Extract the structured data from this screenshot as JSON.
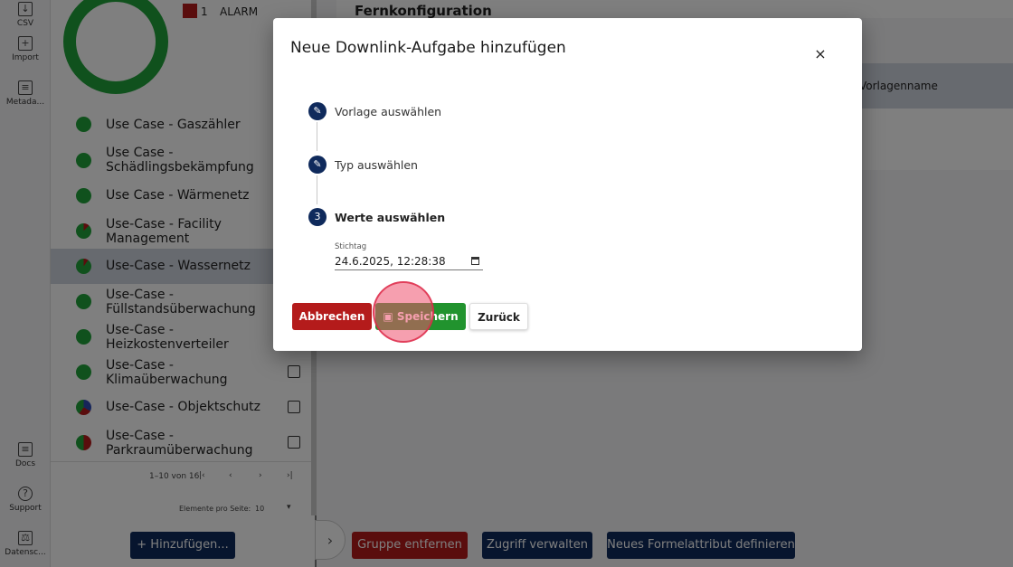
{
  "rail": {
    "items": [
      {
        "label": "CSV",
        "icon": "csv-icon"
      },
      {
        "label": "Import",
        "icon": "import-icon"
      },
      {
        "label": "Metada...",
        "icon": "metadata-icon"
      },
      {
        "label": "Docs",
        "icon": "docs-icon"
      },
      {
        "label": "Support",
        "icon": "help-icon"
      },
      {
        "label": "Datensc...",
        "icon": "privacy-icon"
      }
    ]
  },
  "legend": {
    "count": "1",
    "label": "ALARM",
    "color": "#b41b1b"
  },
  "groups": {
    "items": [
      {
        "label": "Use Case - Gaszähler"
      },
      {
        "label": "Use Case - Schädlingsbekämpfung"
      },
      {
        "label": "Use Case - Wärmenetz"
      },
      {
        "label": "Use-Case - Facility Management"
      },
      {
        "label": "Use-Case - Wassernetz"
      },
      {
        "label": "Use-Case - Füllstandsüberwachung"
      },
      {
        "label": "Use-Case - Heizkostenverteiler"
      },
      {
        "label": "Use-Case - Klimaüberwachung"
      },
      {
        "label": "Use-Case - Objektschutz"
      },
      {
        "label": "Use-Case - Parkraumüberwachung"
      }
    ],
    "selected_index": 4
  },
  "pager": {
    "range": "1–10 von 16",
    "per_page_label": "Elemente pro Seite:",
    "per_page_value": "10"
  },
  "add_button": "+ Hinzufügen...",
  "main": {
    "title": "Fernkonfiguration",
    "column_header": "Vorlagenname",
    "buttons": {
      "remove_group": "Gruppe entfernen",
      "manage_access": "Zugriff verwalten",
      "define_formula": "Neues Formelattribut definieren"
    }
  },
  "dialog": {
    "title": "Neue Downlink-Aufgabe hinzufügen",
    "close": "×",
    "steps": [
      {
        "label": "Vorlage auswählen",
        "marker": "✎"
      },
      {
        "label": "Typ auswählen",
        "marker": "✎"
      },
      {
        "label": "Werte auswählen",
        "marker": "3"
      }
    ],
    "field": {
      "label": "Stichtag",
      "value": "24.6.2025, 12:28:38"
    },
    "buttons": {
      "cancel": "Abbrechen",
      "save": "Speichern",
      "back": "Zurück"
    }
  },
  "colors": {
    "navy": "#0f2a5c",
    "red": "#b41b1b",
    "green": "#21a33a"
  }
}
